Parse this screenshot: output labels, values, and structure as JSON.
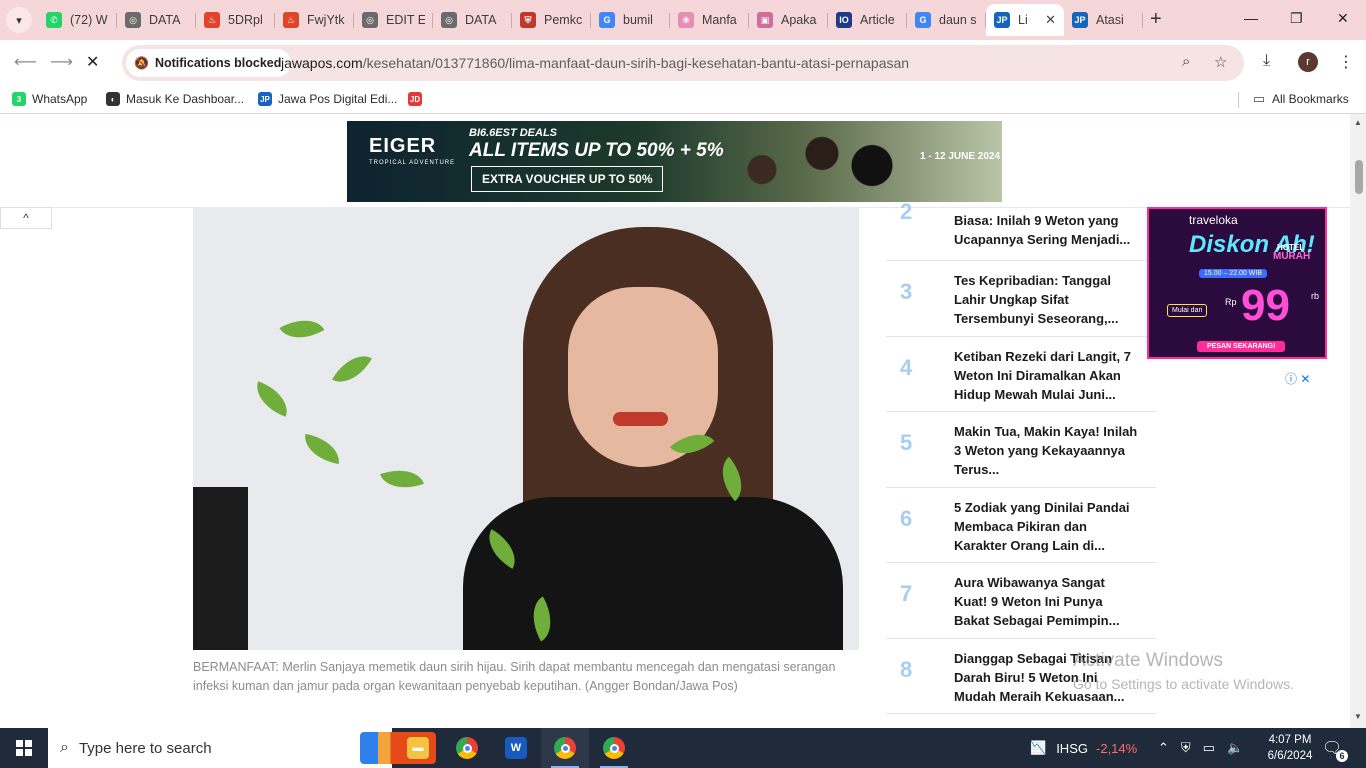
{
  "browser": {
    "tabs": [
      {
        "title": "(72) W",
        "icon": "whatsapp-icon",
        "color": "#25d366",
        "glyph": "✆"
      },
      {
        "title": "DATA",
        "icon": "globe-icon",
        "color": "#6b6b6b",
        "glyph": "◎"
      },
      {
        "title": "5DRpl",
        "icon": "fire-icon",
        "color": "#e0452c",
        "glyph": "♨"
      },
      {
        "title": "FwjYtk",
        "icon": "fire-icon",
        "color": "#e0452c",
        "glyph": "♨"
      },
      {
        "title": "EDIT E",
        "icon": "globe-icon",
        "color": "#6b6b6b",
        "glyph": "◎"
      },
      {
        "title": "DATA",
        "icon": "globe-icon",
        "color": "#6b6b6b",
        "glyph": "◎"
      },
      {
        "title": "Pemkc",
        "icon": "shield-crest-icon",
        "color": "#c0392b",
        "glyph": "⛨"
      },
      {
        "title": "bumil",
        "icon": "google-icon",
        "color": "#4285f4",
        "glyph": "G"
      },
      {
        "title": "Manfa",
        "icon": "leaf-icon",
        "color": "#e58fb6",
        "glyph": "❀"
      },
      {
        "title": "Apaka",
        "icon": "doc-icon",
        "color": "#d16b9a",
        "glyph": "▣"
      },
      {
        "title": "Article",
        "icon": "io-icon",
        "color": "#1e3a8a",
        "glyph": "IO"
      },
      {
        "title": "daun s",
        "icon": "google-icon",
        "color": "#4285f4",
        "glyph": "G"
      },
      {
        "title": "Li",
        "icon": "jawapos-icon",
        "color": "#1565c0",
        "glyph": "JP",
        "active": true
      },
      {
        "title": "Atasi",
        "icon": "jawapos-icon",
        "color": "#1565c0",
        "glyph": "JP"
      }
    ],
    "new_tab": "+",
    "window_controls": {
      "minimize": "—",
      "maximize": "❐",
      "close": "✕"
    },
    "notifications_chip": "Notifications blocked",
    "url_domain": "jawapos.com",
    "url_path": "/kesehatan/013771860/lima-manfaat-daun-sirih-bagi-kesehatan-bantu-atasi-pernapasan",
    "profile_initial": "r",
    "bookmarks": [
      {
        "label": "WhatsApp",
        "icon": "whatsapp-icon",
        "color": "#25d366",
        "glyph": "3"
      },
      {
        "label": "Masuk Ke Dashboar...",
        "icon": "globe-icon",
        "color": "#333333",
        "glyph": "◐"
      },
      {
        "label": "Jawa Pos Digital Edi...",
        "icon": "jawapos-icon",
        "color": "#1565c0",
        "glyph": "JP"
      },
      {
        "label": "",
        "icon": "jdih-icon",
        "color": "#e53935",
        "glyph": "JD"
      }
    ],
    "all_bookmarks": "All Bookmarks"
  },
  "page": {
    "top_ad": {
      "brand": "EIGER",
      "brand_sub": "TROPICAL ADVENTURE",
      "deal": "BI6.6EST DEALS",
      "items": "ALL ITEMS UP TO 50% + 5%",
      "voucher": "EXTRA VOUCHER UP TO 50%",
      "date": "1 - 12 JUNE 2024"
    },
    "scroll_top": "^",
    "caption": "BERMANFAAT: Merlin Sanjaya memetik daun sirih hijau. Sirih dapat membantu mencegah dan mengatasi serangan infeksi kuman dan jamur pada organ kewanitaan penyebab keputihan. (Angger Bondan/Jawa Pos)",
    "trending": [
      {
        "rank": "2",
        "title": "Biasa: Inilah 9 Weton yang Ucapannya Sering Menjadi..."
      },
      {
        "rank": "3",
        "title": "Tes Kepribadian: Tanggal Lahir Ungkap Sifat Tersembunyi Seseorang,..."
      },
      {
        "rank": "4",
        "title": "Ketiban Rezeki dari Langit, 7 Weton Ini Diramalkan Akan Hidup Mewah Mulai Juni..."
      },
      {
        "rank": "5",
        "title": "Makin Tua, Makin Kaya! Inilah 3 Weton yang Kekayaannya Terus..."
      },
      {
        "rank": "6",
        "title": "5 Zodiak yang Dinilai Pandai Membaca Pikiran dan Karakter Orang Lain di..."
      },
      {
        "rank": "7",
        "title": "Aura Wibawanya Sangat Kuat! 9 Weton Ini Punya Bakat Sebagai Pemimpin..."
      },
      {
        "rank": "8",
        "title": "Dianggap Sebagai Titisan Darah Biru! 5 Weton Ini Mudah Meraih Kekuasaan..."
      }
    ],
    "side_ad": {
      "brand": "traveloka",
      "headline": "Diskon Ah!",
      "hotel": "HOTEL",
      "murah": "MURAH",
      "time": "15.00 – 22.00 WIB",
      "from": "Mulai dari",
      "rp": "Rp",
      "price": "99",
      "price_suffix": "rb",
      "cta": "PESAN SEKARANG!"
    },
    "ad_choices": "ⓘ ✕",
    "activate_title": "Activate Windows",
    "activate_sub": "Go to Settings to activate Windows."
  },
  "taskbar": {
    "search_placeholder": "Type here to search",
    "apps": [
      {
        "name": "file-explorer-icon",
        "color": "#f6c243",
        "glyph": "▬"
      },
      {
        "name": "chrome-icon"
      },
      {
        "name": "word-icon",
        "color": "#185abd",
        "glyph": "W"
      },
      {
        "name": "chrome-icon",
        "active": true
      },
      {
        "name": "chrome-icon",
        "open": true
      }
    ],
    "ihsg_label": "IHSG",
    "ihsg_value": "-2,14%",
    "time": "4:07 PM",
    "date": "6/6/2024",
    "notification_count": "6"
  }
}
